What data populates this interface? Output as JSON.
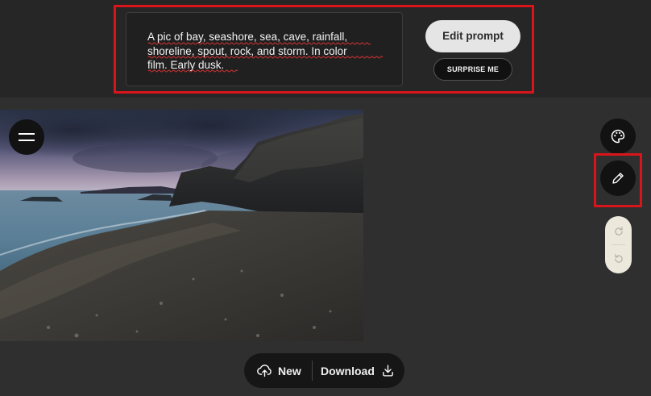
{
  "prompt": {
    "text_line1": "A pic of  bay, seashore, sea, cave, rainfall,",
    "text_line2": "shoreline, spout, rock, and storm. In color",
    "text_line3": "film. Early dusk."
  },
  "actions": {
    "edit_prompt_label": "Edit prompt",
    "surprise_label": "SURPRISE ME"
  },
  "bottom_bar": {
    "new_label": "New",
    "download_label": "Download"
  },
  "icons": {
    "menu": "hamburger-menu-icon",
    "palette": "palette-icon",
    "edit": "pencil-icon",
    "redo": "redo-icon",
    "undo": "undo-icon",
    "upload": "cloud-upload-icon",
    "download": "download-icon"
  },
  "colors": {
    "highlight": "#d9141b",
    "topbar_bg": "#262626",
    "page_bg": "#2f2f2f",
    "pill_bg": "#ece8dc"
  }
}
